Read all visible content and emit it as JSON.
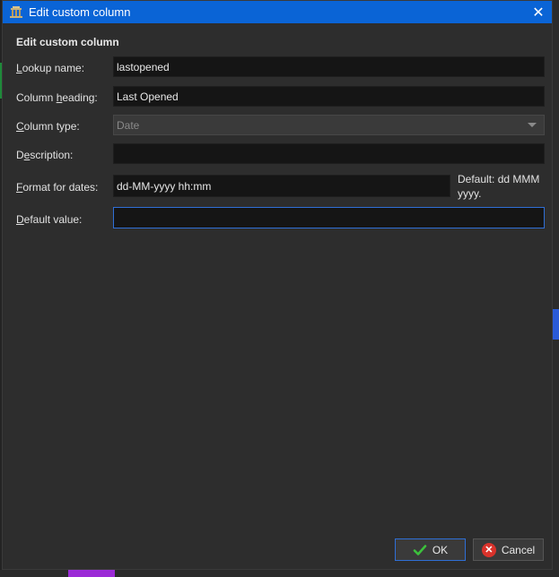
{
  "window": {
    "title": "Edit custom column",
    "close_glyph": "✕"
  },
  "form": {
    "section_title": "Edit custom column",
    "lookup_name": {
      "label_key": "L",
      "label_rest": "ookup name:",
      "value": "lastopened"
    },
    "column_heading": {
      "label_pre": "Column ",
      "label_key": "h",
      "label_rest": "eading:",
      "value": "Last Opened"
    },
    "column_type": {
      "label_key": "C",
      "label_rest": "olumn type:",
      "value": "Date"
    },
    "description": {
      "label_pre": "D",
      "label_key": "e",
      "label_rest": "scription:",
      "value": ""
    },
    "format_for_dates": {
      "label_key": "F",
      "label_rest": "ormat for dates:",
      "value": "dd-MM-yyyy hh:mm",
      "default_hint": "Default: dd MMM yyyy."
    },
    "default_value": {
      "label_key": "D",
      "label_rest": "efault value:",
      "value": ""
    }
  },
  "buttons": {
    "ok_label": "OK",
    "cancel_label": "Cancel"
  },
  "icons": {
    "app": "calibre-icon",
    "ok": "checkmark-icon",
    "cancel": "cancel-icon"
  },
  "colors": {
    "titlebar": "#0a64d6",
    "focus": "#2f6fd6",
    "ok_check": "#3cc13c",
    "cancel_red": "#d9322b"
  }
}
